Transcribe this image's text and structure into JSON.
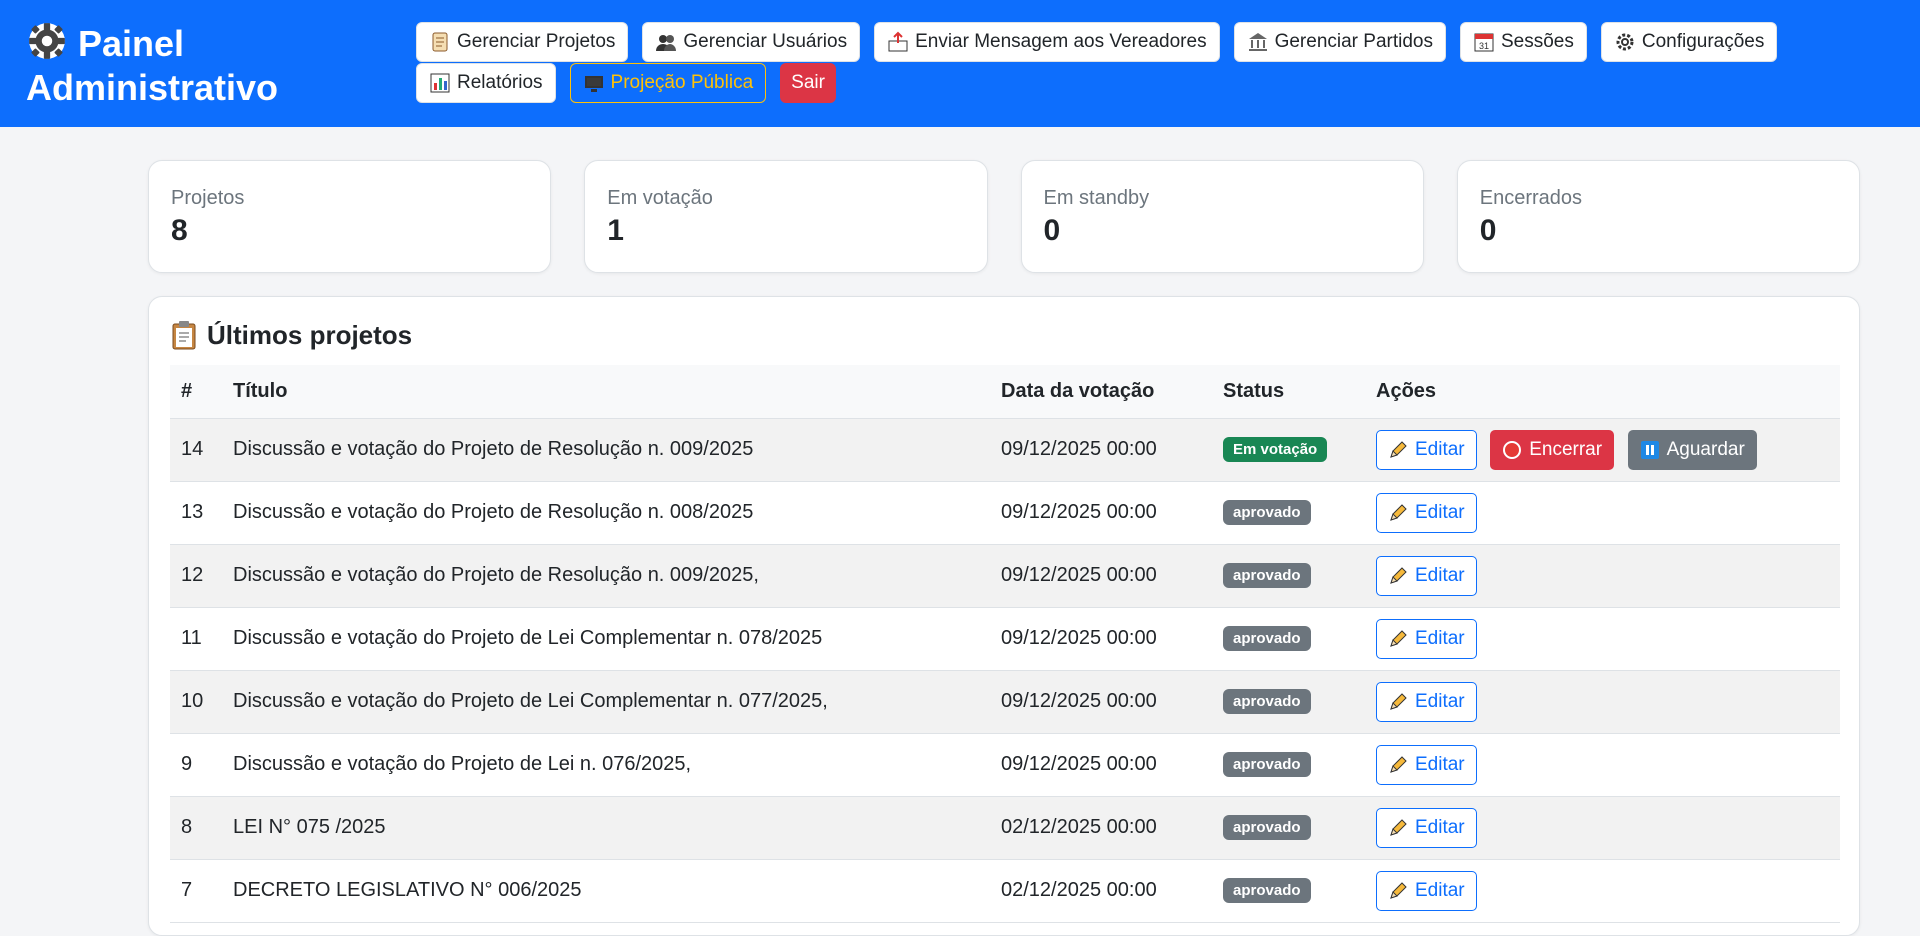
{
  "header": {
    "title": "Painel Administrativo",
    "nav": [
      {
        "label": "Gerenciar Projetos",
        "icon": "scroll-icon"
      },
      {
        "label": "Gerenciar Usuários",
        "icon": "users-icon"
      },
      {
        "label": "Enviar Mensagem aos Vereadores",
        "icon": "outbox-icon"
      },
      {
        "label": "Gerenciar Partidos",
        "icon": "bank-icon"
      },
      {
        "label": "Sessões",
        "icon": "calendar-icon"
      },
      {
        "label": "Configurações",
        "icon": "gear-icon"
      },
      {
        "label": "Relatórios",
        "icon": "bar-chart-icon"
      },
      {
        "label": "Projeção Pública",
        "icon": "monitor-icon"
      },
      {
        "label": "Sair",
        "icon": ""
      }
    ]
  },
  "stats": [
    {
      "label": "Projetos",
      "value": "8"
    },
    {
      "label": "Em votação",
      "value": "1"
    },
    {
      "label": "Em standby",
      "value": "0"
    },
    {
      "label": "Encerrados",
      "value": "0"
    }
  ],
  "projects": {
    "title": "Últimos projetos",
    "columns": [
      "#",
      "Título",
      "Data da votação",
      "Status",
      "Ações"
    ],
    "actions": {
      "edit": "Editar",
      "close": "Encerrar",
      "wait": "Aguardar"
    },
    "rows": [
      {
        "id": "14",
        "title": "Discussão e votação do Projeto de Resolução n. 009/2025",
        "date": "09/12/2025 00:00",
        "status": "Em votação"
      },
      {
        "id": "13",
        "title": "Discussão e votação do Projeto de Resolução n. 008/2025",
        "date": "09/12/2025 00:00",
        "status": "aprovado"
      },
      {
        "id": "12",
        "title": "Discussão e votação do Projeto de Resolução n. 009/2025,",
        "date": "09/12/2025 00:00",
        "status": "aprovado"
      },
      {
        "id": "11",
        "title": "Discussão e votação do Projeto de Lei Complementar n. 078/2025",
        "date": "09/12/2025 00:00",
        "status": "aprovado"
      },
      {
        "id": "10",
        "title": "Discussão e votação do Projeto de Lei Complementar n. 077/2025,",
        "date": "09/12/2025 00:00",
        "status": "aprovado"
      },
      {
        "id": "9",
        "title": "Discussão e votação do Projeto de Lei n. 076/2025,",
        "date": "09/12/2025 00:00",
        "status": "aprovado"
      },
      {
        "id": "8",
        "title": "LEI N° 075 /2025",
        "date": "02/12/2025 00:00",
        "status": "aprovado"
      },
      {
        "id": "7",
        "title": "DECRETO LEGISLATIVO N° 006/2025",
        "date": "02/12/2025 00:00",
        "status": "aprovado"
      }
    ]
  },
  "colors": {
    "primary": "#0d6efd",
    "success": "#198754",
    "danger": "#dc3545",
    "secondary": "#6c757d",
    "warning": "#ffc107"
  }
}
